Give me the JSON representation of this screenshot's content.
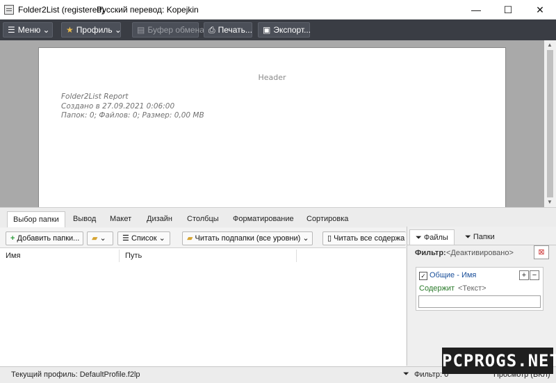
{
  "window": {
    "title": "Folder2List (registered)",
    "subtitle": "Русский перевод: Kopejkin",
    "minimize": "—",
    "maximize": "☐",
    "close": "✕"
  },
  "toolbar": {
    "menu": "Меню",
    "profile": "Профиль",
    "clipboard": "Буфер обмена",
    "print": "Печать...",
    "export": "Экспорт..."
  },
  "preview": {
    "header": "Header",
    "report_title": "Folder2List Report",
    "created": "Создано  в  27.09.2021  0:06:00",
    "stats": "Папок: 0;   Файлов: 0;   Размер: 0,00 MB"
  },
  "tabs": [
    "Выбор папки",
    "Вывод",
    "Макет",
    "Дизайн",
    "Столбцы",
    "Форматирование",
    "Сортировка"
  ],
  "toolbar2": {
    "add_folder": "Добавить папки...",
    "list": "Список",
    "read_subfolders": "Читать подпапки (все уровни)",
    "read_all": "Читать все содержа"
  },
  "table": {
    "columns": [
      "Имя",
      "Путь"
    ]
  },
  "right_panel": {
    "tab_files": "Файлы",
    "tab_folders": "Папки",
    "filter_label": "Фильтр:",
    "filter_value": "<Деактивировано>",
    "rule_title": "Общие - Имя",
    "rule_op": "Содержит",
    "rule_value": "<Текст>"
  },
  "status": {
    "profile": "Текущий профиль: DefaultProfile.f2lp",
    "filter": "Фильтр: 0",
    "view": "Просмотр (ВКЛ)"
  },
  "watermark": "PCPROGS.NET"
}
